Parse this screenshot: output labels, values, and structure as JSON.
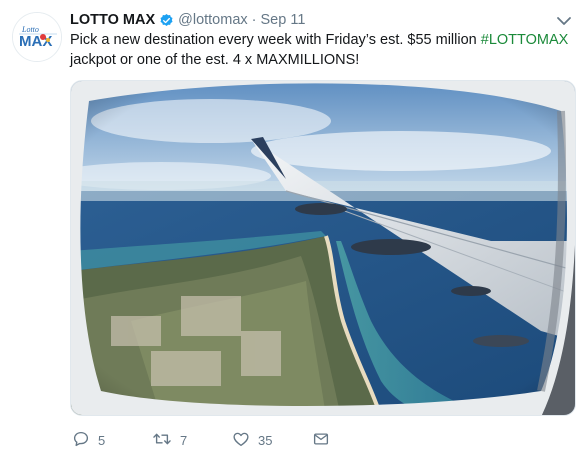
{
  "tweet": {
    "display_name": "LOTTO MAX",
    "handle": "@lottomax",
    "separator": "·",
    "date": "Sep 11",
    "text_plain": "Pick a new destination every week with Friday’s est. $55 million ",
    "hashtag": "#LOTTOMAX",
    "text_line2": "jackpot or one of the est. 4 x MAXMILLIONS!",
    "avatar_logo_small": "Lotto",
    "avatar_logo_big": "MAX"
  },
  "actions": {
    "reply_count": "5",
    "retweet_count": "7",
    "like_count": "35"
  },
  "icons": {
    "verified": "verified-badge-icon",
    "caret": "chevron-down-icon",
    "reply": "comment-icon",
    "retweet": "retweet-icon",
    "like": "heart-icon",
    "dm": "envelope-icon"
  },
  "colors": {
    "hashtag": "#1b8a3a",
    "verified": "#1da1f2",
    "muted": "#657786"
  }
}
